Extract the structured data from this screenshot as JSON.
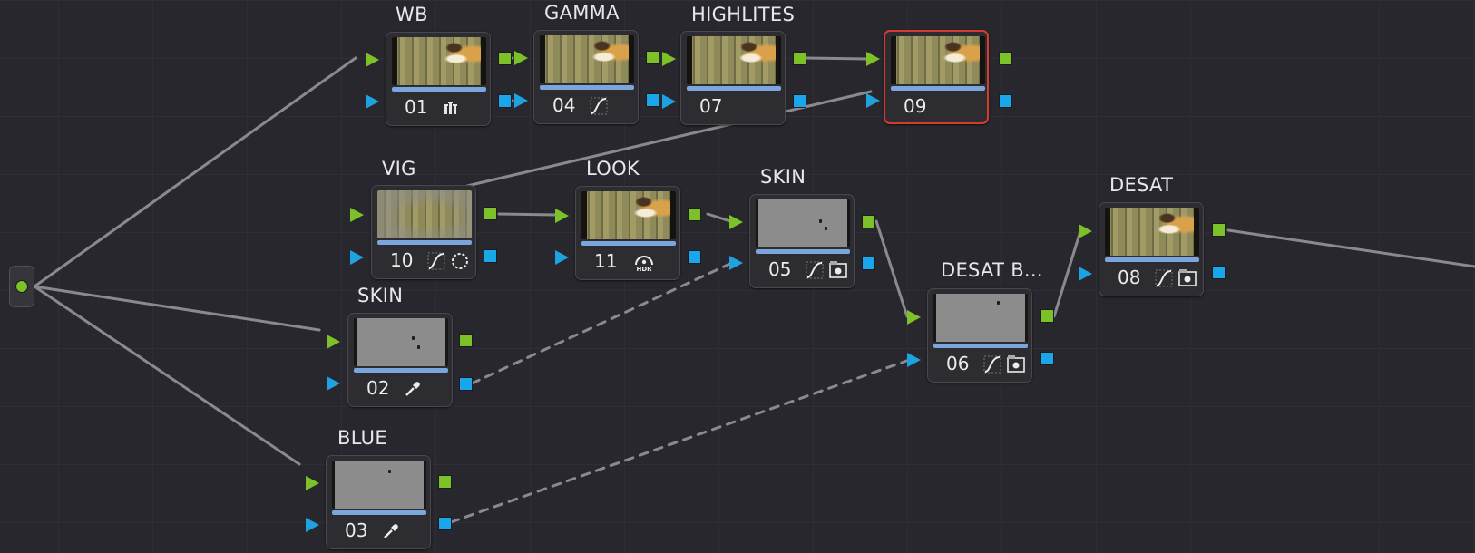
{
  "graph": {
    "source_node": {
      "color": "#7dc128"
    },
    "nodes": [
      {
        "id": "01",
        "title": "WB",
        "label": "01",
        "tools": [
          "bars-icon"
        ]
      },
      {
        "id": "04",
        "title": "GAMMA",
        "label": "04",
        "tools": [
          "curves-icon"
        ]
      },
      {
        "id": "07",
        "title": "HIGHLITES",
        "label": "07",
        "tools": []
      },
      {
        "id": "09",
        "title": "",
        "label": "09",
        "tools": [],
        "selected": true
      },
      {
        "id": "10",
        "title": "VIG",
        "label": "10",
        "tools": [
          "curves-icon",
          "window-circle-icon"
        ]
      },
      {
        "id": "11",
        "title": "LOOK",
        "label": "11",
        "tools": [
          "hdr-icon"
        ]
      },
      {
        "id": "05",
        "title": "SKIN",
        "label": "05",
        "tools": [
          "curves-icon",
          "qualifier-key-icon"
        ]
      },
      {
        "id": "06",
        "title": "DESAT B...",
        "label": "06",
        "tools": [
          "curves-icon",
          "qualifier-key-icon"
        ]
      },
      {
        "id": "08",
        "title": "DESAT",
        "label": "08",
        "tools": [
          "curves-icon",
          "qualifier-key-icon"
        ]
      },
      {
        "id": "02",
        "title": "SKIN",
        "label": "02",
        "tools": [
          "eyedropper-icon"
        ]
      },
      {
        "id": "03",
        "title": "BLUE",
        "label": "03",
        "tools": [
          "eyedropper-icon"
        ]
      }
    ]
  },
  "colors": {
    "rgb_input": "#7dc128",
    "key_input": "#1fa2e0",
    "selected_border": "#d63b30",
    "progress": "#7aa6dc",
    "wire": "#8a8a8e"
  }
}
